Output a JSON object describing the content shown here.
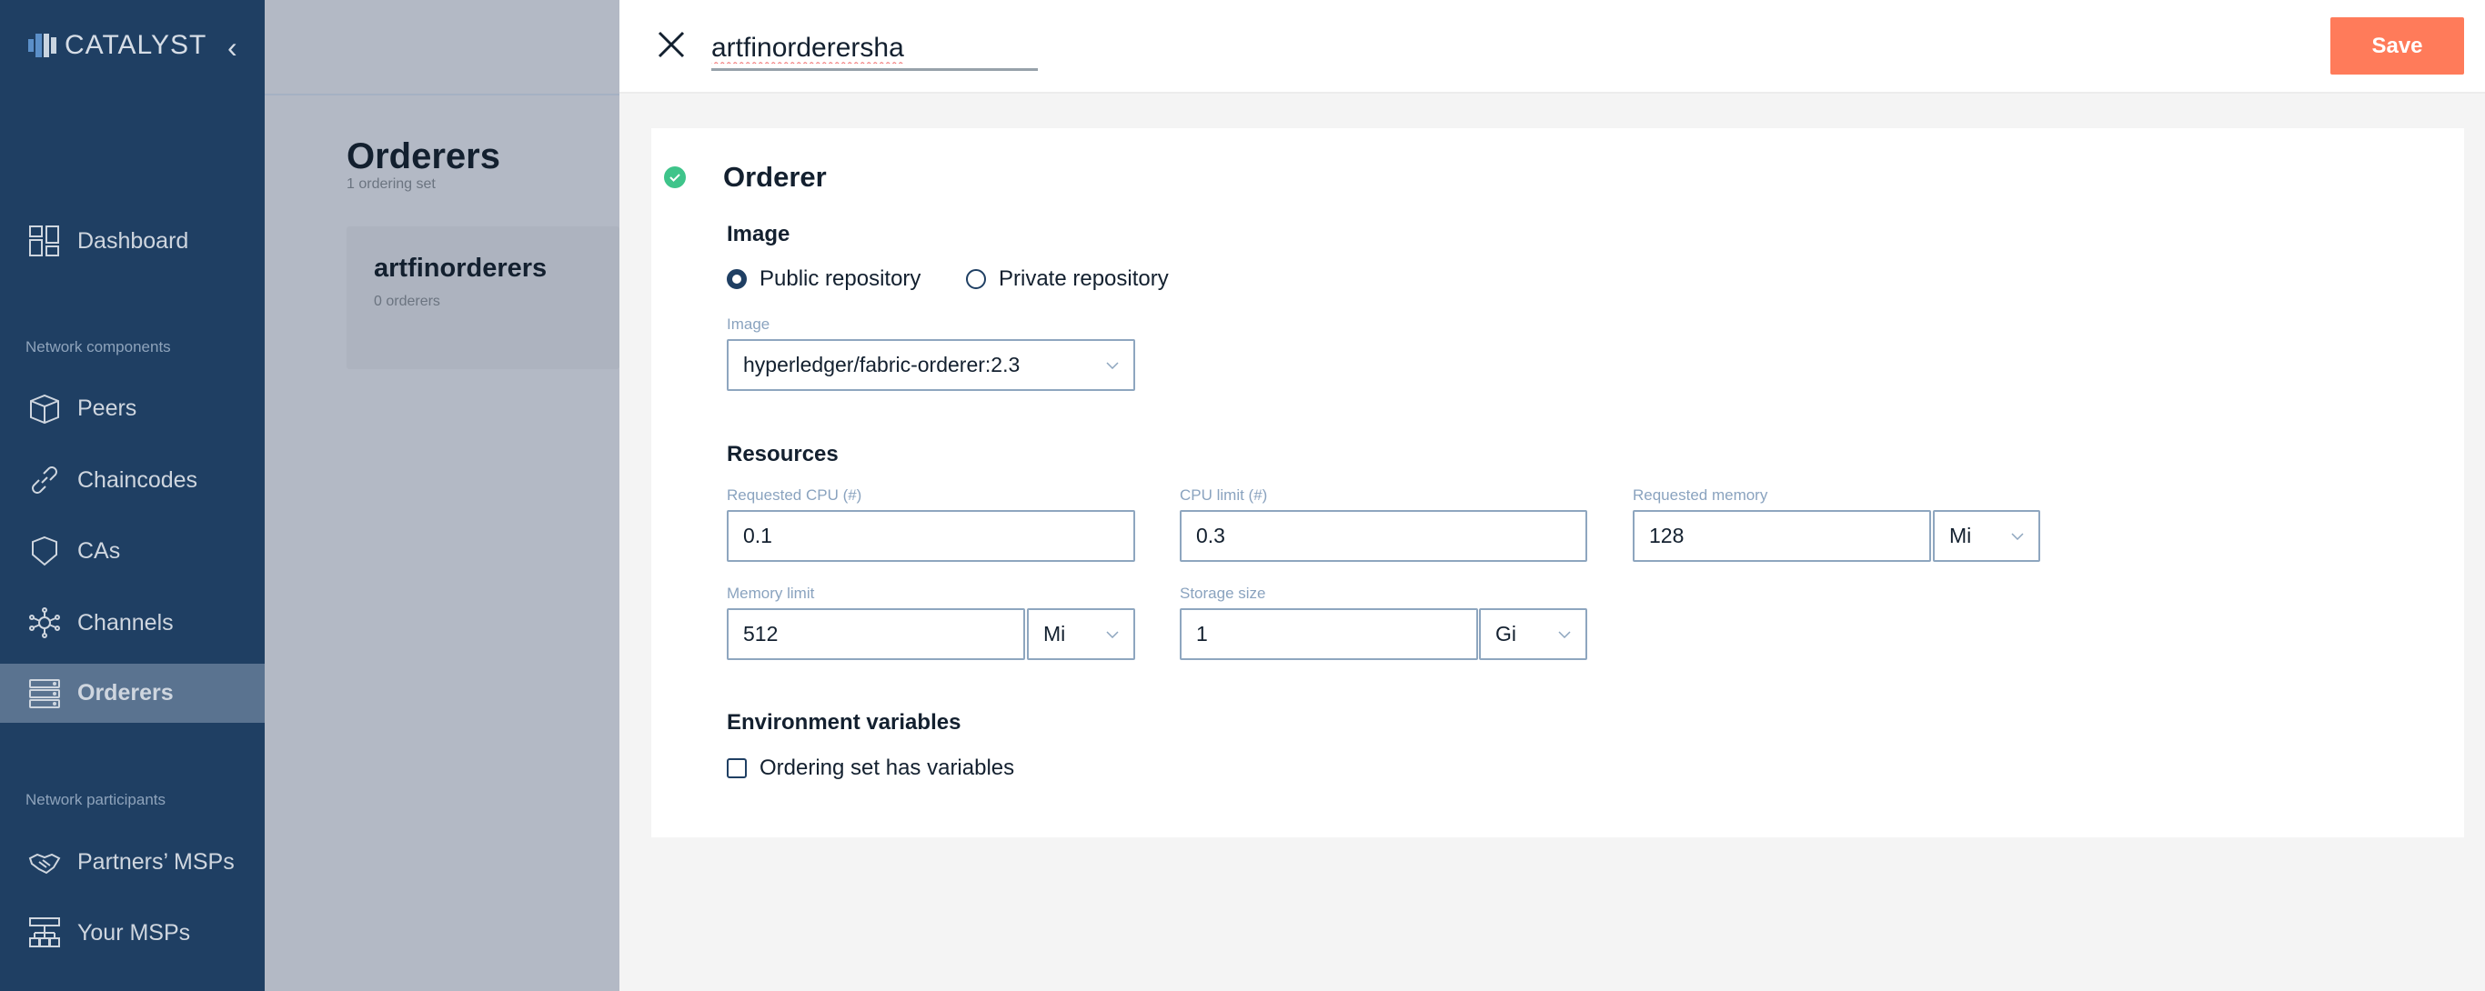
{
  "sidebar": {
    "logo": "CATALYST",
    "sections": {
      "components": "Network components",
      "participants": "Network participants"
    },
    "items": [
      {
        "label": "Dashboard",
        "icon": "dashboard-icon"
      },
      {
        "label": "Peers",
        "icon": "cube-icon"
      },
      {
        "label": "Chaincodes",
        "icon": "link-icon"
      },
      {
        "label": "CAs",
        "icon": "shield-icon"
      },
      {
        "label": "Channels",
        "icon": "network-icon"
      },
      {
        "label": "Orderers",
        "icon": "server-icon",
        "active": true
      },
      {
        "label": "Partners’ MSPs",
        "icon": "handshake-icon"
      },
      {
        "label": "Your MSPs",
        "icon": "hierarchy-icon"
      }
    ]
  },
  "list": {
    "title": "Orderers",
    "subtitle": "1 ordering set",
    "card": {
      "name": "artfinorderers",
      "count": "0 orderers"
    }
  },
  "detail": {
    "name_value": "artfinorderersha",
    "save_label": "Save",
    "section_title": "Orderer",
    "image": {
      "heading": "Image",
      "public_label": "Public repository",
      "private_label": "Private repository",
      "selected": "public",
      "field_label": "Image",
      "value": "hyperledger/fabric-orderer:2.3"
    },
    "resources": {
      "heading": "Resources",
      "requested_cpu": {
        "label": "Requested CPU (#)",
        "value": "0.1"
      },
      "cpu_limit": {
        "label": "CPU limit (#)",
        "value": "0.3"
      },
      "requested_memory": {
        "label": "Requested memory",
        "value": "128",
        "unit": "Mi"
      },
      "memory_limit": {
        "label": "Memory limit",
        "value": "512",
        "unit": "Mi"
      },
      "storage_size": {
        "label": "Storage size",
        "value": "1",
        "unit": "Gi"
      }
    },
    "env": {
      "heading": "Environment variables",
      "checkbox_label": "Ordering set has variables",
      "checked": false
    }
  },
  "colors": {
    "sidebar": "#1f3f63",
    "accent": "#ff7b5a",
    "success": "#3ec48a"
  }
}
